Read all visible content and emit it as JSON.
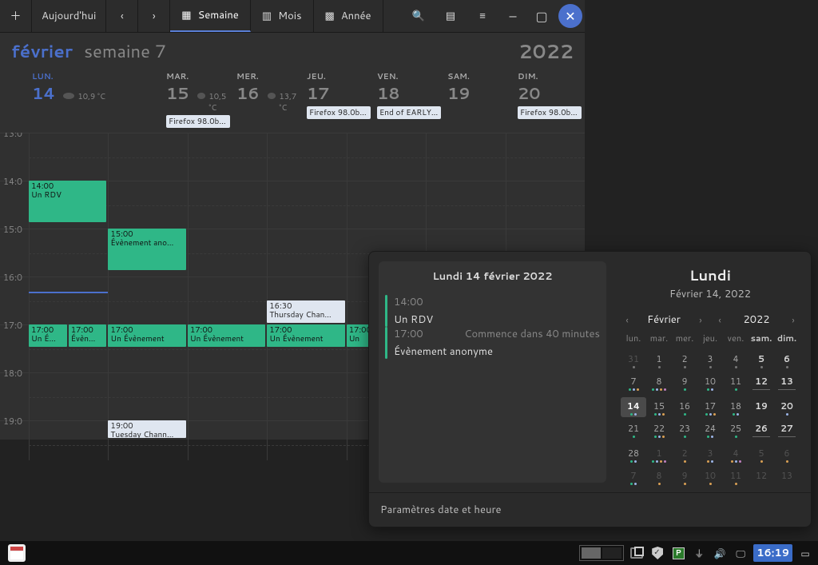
{
  "toolbar": {
    "today_label": "Aujourd'hui",
    "views": {
      "week": "Semaine",
      "month": "Mois",
      "year": "Année"
    }
  },
  "header": {
    "month": "février",
    "week": "semaine 7",
    "year": "2022"
  },
  "days": [
    {
      "abbr": "LUN.",
      "num": "14",
      "selected": true,
      "temp": "10,9 °C",
      "weather": true,
      "allday": null
    },
    {
      "abbr": "MAR.",
      "num": "15",
      "selected": false,
      "temp": "10,5 °C",
      "weather": true,
      "allday": "Firefox 98.0b…"
    },
    {
      "abbr": "MER.",
      "num": "16",
      "selected": false,
      "temp": "13,7 °C",
      "weather": true,
      "allday": null
    },
    {
      "abbr": "JEU.",
      "num": "17",
      "selected": false,
      "temp": null,
      "weather": false,
      "allday": "Firefox 98.0b…"
    },
    {
      "abbr": "VEN.",
      "num": "18",
      "selected": false,
      "temp": null,
      "weather": false,
      "allday": "End of EARLY…"
    },
    {
      "abbr": "SAM.",
      "num": "19",
      "selected": false,
      "temp": null,
      "weather": false,
      "allday": null
    },
    {
      "abbr": "DIM.",
      "num": "20",
      "selected": false,
      "temp": null,
      "weather": false,
      "allday": "Firefox 98.0b…"
    }
  ],
  "hours": [
    "13:0",
    "14:0",
    "15:0",
    "16:0",
    "17:0",
    "18:0",
    "19:0"
  ],
  "events": [
    {
      "col": 0,
      "sub": 0,
      "subs": 1,
      "row": 1,
      "span": 1,
      "time": "14:00",
      "title": "Un RDV",
      "cls": "",
      "tall": true
    },
    {
      "col": 1,
      "sub": 0,
      "subs": 1,
      "row": 2,
      "span": 1,
      "time": "15:00",
      "title": "Évènement ano…",
      "cls": "",
      "tall": true
    },
    {
      "col": 3,
      "sub": 0,
      "subs": 1,
      "row": 3.5,
      "span": 0.5,
      "time": "16:30",
      "title": "Thursday Chan…",
      "cls": "blue"
    },
    {
      "col": 0,
      "sub": 0,
      "subs": 2,
      "row": 4,
      "span": 0.5,
      "time": "17:00",
      "title": "Un É…",
      "cls": ""
    },
    {
      "col": 0,
      "sub": 1,
      "subs": 2,
      "row": 4,
      "span": 0.5,
      "time": "17:00",
      "title": "Évèn…",
      "cls": ""
    },
    {
      "col": 1,
      "sub": 0,
      "subs": 1,
      "row": 4,
      "span": 0.5,
      "time": "17:00",
      "title": "Un Évènement",
      "cls": ""
    },
    {
      "col": 2,
      "sub": 0,
      "subs": 1,
      "row": 4,
      "span": 0.5,
      "time": "17:00",
      "title": "Un Évènement",
      "cls": ""
    },
    {
      "col": 3,
      "sub": 0,
      "subs": 1,
      "row": 4,
      "span": 0.5,
      "time": "17:00",
      "title": "Un Évènement",
      "cls": ""
    },
    {
      "col": 4,
      "sub": 0,
      "subs": 1,
      "row": 4,
      "span": 0.5,
      "time": "17:00",
      "title": "Un",
      "cls": ""
    },
    {
      "col": 1,
      "sub": 0,
      "subs": 1,
      "row": 6,
      "span": 0.4,
      "time": "19:00",
      "title": "Tuesday Chann…",
      "cls": "blue"
    }
  ],
  "popover": {
    "agenda_title": "Lundi 14 février 2022",
    "items": [
      {
        "time": "14:00",
        "title": "Un RDV",
        "sub": ""
      },
      {
        "time": "17:00",
        "title": "Évènement anonyme",
        "sub": "Commence dans 40 minutes"
      }
    ],
    "big_day": "Lundi",
    "big_date": "Février 14, 2022",
    "nav_month": "Février",
    "nav_year": "2022",
    "weekday_heads": [
      "lun.",
      "mar.",
      "mer.",
      "jeu.",
      "ven.",
      "sam.",
      "dim."
    ],
    "cells": [
      {
        "n": "31",
        "o": 1
      },
      {
        "n": "1"
      },
      {
        "n": "2"
      },
      {
        "n": "3"
      },
      {
        "n": "4"
      },
      {
        "n": "5",
        "w": 1
      },
      {
        "n": "6",
        "w": 1
      },
      {
        "n": "7"
      },
      {
        "n": "8"
      },
      {
        "n": "9"
      },
      {
        "n": "10"
      },
      {
        "n": "11"
      },
      {
        "n": "12",
        "w": 1,
        "ul": 1
      },
      {
        "n": "13",
        "w": 1,
        "ul": 1
      },
      {
        "n": "14",
        "sel": 1
      },
      {
        "n": "15"
      },
      {
        "n": "16"
      },
      {
        "n": "17"
      },
      {
        "n": "18"
      },
      {
        "n": "19",
        "w": 1
      },
      {
        "n": "20",
        "w": 1
      },
      {
        "n": "21"
      },
      {
        "n": "22"
      },
      {
        "n": "23"
      },
      {
        "n": "24"
      },
      {
        "n": "25"
      },
      {
        "n": "26",
        "w": 1,
        "ul": 1
      },
      {
        "n": "27",
        "w": 1,
        "ul": 1
      },
      {
        "n": "28"
      },
      {
        "n": "1",
        "o": 1
      },
      {
        "n": "2",
        "o": 1
      },
      {
        "n": "3",
        "o": 1
      },
      {
        "n": "4",
        "o": 1
      },
      {
        "n": "5",
        "o": 1
      },
      {
        "n": "6",
        "o": 1
      },
      {
        "n": "7",
        "o": 1
      },
      {
        "n": "8",
        "o": 1
      },
      {
        "n": "9",
        "o": 1
      },
      {
        "n": "10",
        "o": 1
      },
      {
        "n": "11",
        "o": 1
      },
      {
        "n": "12",
        "o": 1
      },
      {
        "n": "13",
        "o": 1
      }
    ],
    "cell_dots": {
      "0": [
        "dgr"
      ],
      "1": [
        "dgr"
      ],
      "2": [
        "dgr"
      ],
      "3": [
        "dgr"
      ],
      "4": [
        "dgr"
      ],
      "5": [
        "dgr"
      ],
      "6": [
        "dgr"
      ],
      "7": [
        "dg",
        "db",
        "do"
      ],
      "8": [
        "dg",
        "db",
        "do",
        "dp"
      ],
      "9": [
        "dg"
      ],
      "10": [
        "dg",
        "db"
      ],
      "11": [
        "dg"
      ],
      "12": [],
      "13": [],
      "14": [
        "dg",
        "db"
      ],
      "15": [
        "dg",
        "db",
        "do"
      ],
      "16": [
        "dg"
      ],
      "17": [
        "dg",
        "db",
        "do"
      ],
      "18": [
        "dg",
        "db"
      ],
      "19": [],
      "20": [
        "db"
      ],
      "21": [
        "dg"
      ],
      "22": [
        "dg",
        "db",
        "do"
      ],
      "23": [
        "dg"
      ],
      "24": [
        "dg",
        "db"
      ],
      "25": [
        "dg"
      ],
      "26": [],
      "27": [],
      "28": [
        "dg",
        "db"
      ],
      "29": [
        "dg",
        "db",
        "do",
        "dp"
      ],
      "30": [
        "do"
      ],
      "31": [
        "do",
        "db"
      ],
      "32": [
        "do",
        "db",
        "dp"
      ],
      "33": [
        "do"
      ],
      "34": [
        "do"
      ],
      "35": [
        "dg",
        "db"
      ],
      "36": [
        "do"
      ],
      "37": [
        "do"
      ],
      "38": [
        "do"
      ],
      "39": [
        "do"
      ],
      "40": [],
      "41": []
    },
    "settings_label": "Paramètres date et heure"
  },
  "taskbar": {
    "clock": "16:19",
    "p_label": "P"
  }
}
